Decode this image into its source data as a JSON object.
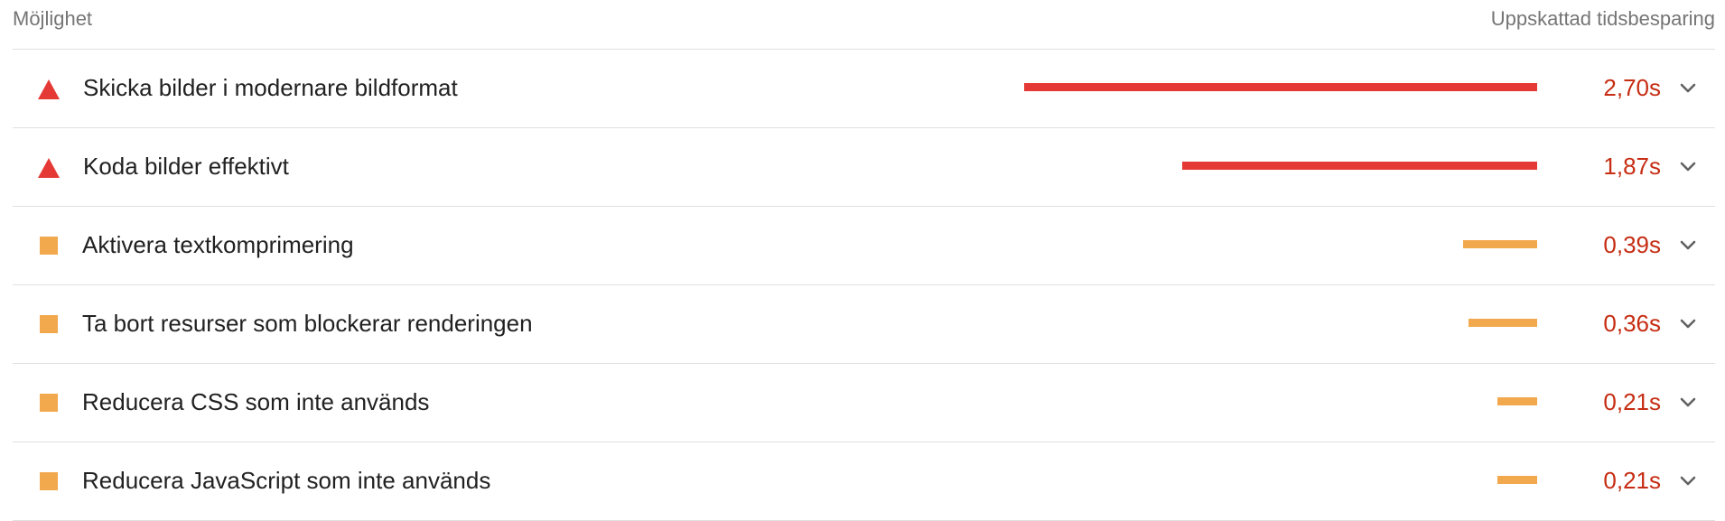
{
  "header": {
    "left_label": "Möjlighet",
    "right_label": "Uppskattad tidsbesparing"
  },
  "colors": {
    "fail": "#e53935",
    "average": "#f2a84c",
    "value_text": "#c62d13"
  },
  "max_savings_seconds": 2.7,
  "opportunities": [
    {
      "icon": "warning-triangle-icon",
      "severity": "fail",
      "title": "Skicka bilder i modernare bildformat",
      "savings": "2,70s",
      "seconds": 2.7
    },
    {
      "icon": "warning-triangle-icon",
      "severity": "fail",
      "title": "Koda bilder effektivt",
      "savings": "1,87s",
      "seconds": 1.87
    },
    {
      "icon": "average-square-icon",
      "severity": "average",
      "title": "Aktivera textkomprimering",
      "savings": "0,39s",
      "seconds": 0.39
    },
    {
      "icon": "average-square-icon",
      "severity": "average",
      "title": "Ta bort resurser som blockerar renderingen",
      "savings": "0,36s",
      "seconds": 0.36
    },
    {
      "icon": "average-square-icon",
      "severity": "average",
      "title": "Reducera CSS som inte används",
      "savings": "0,21s",
      "seconds": 0.21
    },
    {
      "icon": "average-square-icon",
      "severity": "average",
      "title": "Reducera JavaScript som inte används",
      "savings": "0,21s",
      "seconds": 0.21
    }
  ]
}
